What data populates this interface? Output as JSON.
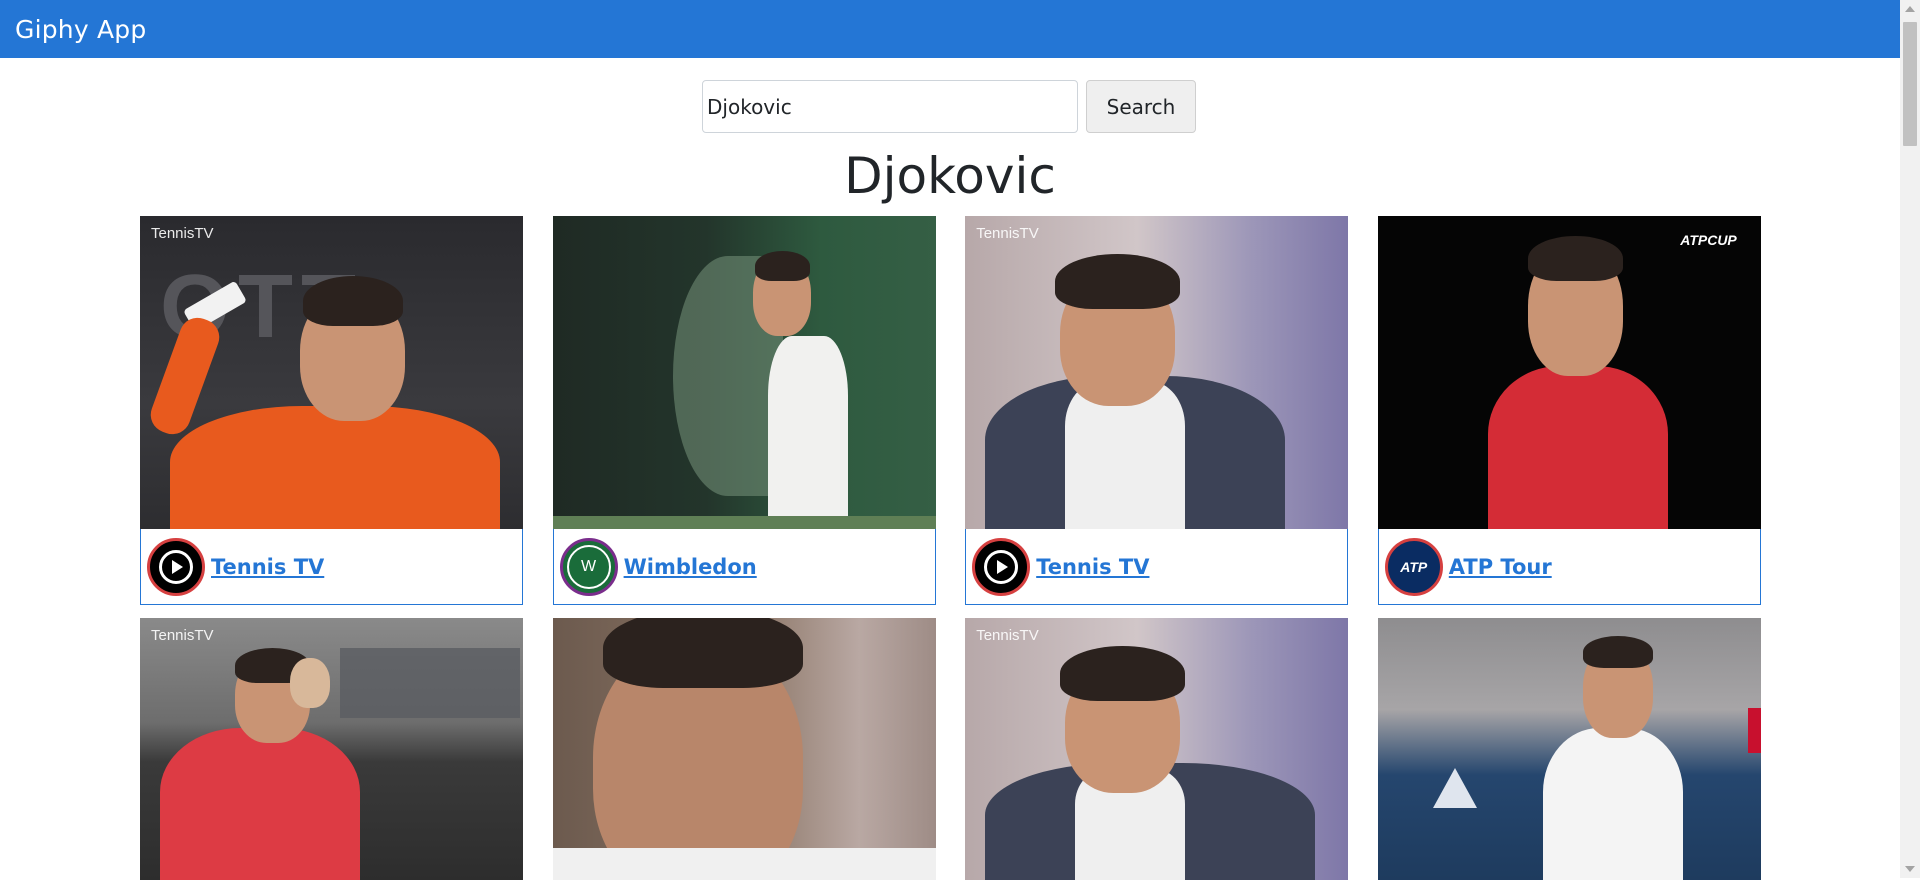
{
  "app": {
    "title": "Giphy App"
  },
  "search": {
    "value": "Djokovic",
    "button_label": "Search"
  },
  "results": {
    "heading": "Djokovic",
    "cards": [
      {
        "author": "Tennis TV",
        "watermark": "TennisTV"
      },
      {
        "author": "Wimbledon",
        "avatar_text": "W"
      },
      {
        "author": "Tennis TV",
        "watermark": "TennisTV"
      },
      {
        "author": "ATP Tour",
        "watermark": "ATPCUP",
        "avatar_text": "ATP"
      }
    ],
    "row2": [
      {
        "watermark": "TennisTV"
      },
      {},
      {
        "watermark": "TennisTV"
      },
      {}
    ]
  },
  "colors": {
    "nav": "#2476d5",
    "link": "#2476d5"
  }
}
